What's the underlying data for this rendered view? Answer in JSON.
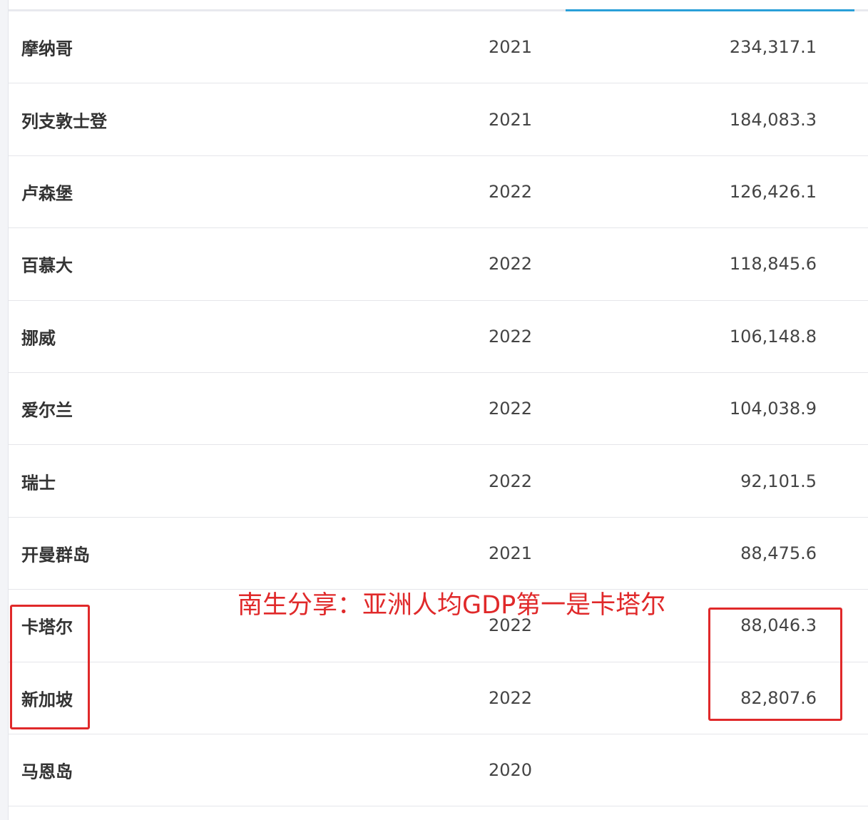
{
  "rows": [
    {
      "country": "摩纳哥",
      "year": "2021",
      "value": "234,317.1"
    },
    {
      "country": "列支敦士登",
      "year": "2021",
      "value": "184,083.3"
    },
    {
      "country": "卢森堡",
      "year": "2022",
      "value": "126,426.1"
    },
    {
      "country": "百慕大",
      "year": "2022",
      "value": "118,845.6"
    },
    {
      "country": "挪威",
      "year": "2022",
      "value": "106,148.8"
    },
    {
      "country": "爱尔兰",
      "year": "2022",
      "value": "104,038.9"
    },
    {
      "country": "瑞士",
      "year": "2022",
      "value": "92,101.5"
    },
    {
      "country": "开曼群岛",
      "year": "2021",
      "value": "88,475.6"
    },
    {
      "country": "卡塔尔",
      "year": "2022",
      "value": "88,046.3"
    },
    {
      "country": "新加坡",
      "year": "2022",
      "value": "82,807.6"
    },
    {
      "country": "马恩岛",
      "year": "2020",
      "value": ""
    }
  ],
  "annotation": {
    "text": "南生分享：亚洲人均GDP第一是卡塔尔"
  },
  "colors": {
    "accent": "#2a9fd8",
    "annotation": "#e0292a"
  }
}
